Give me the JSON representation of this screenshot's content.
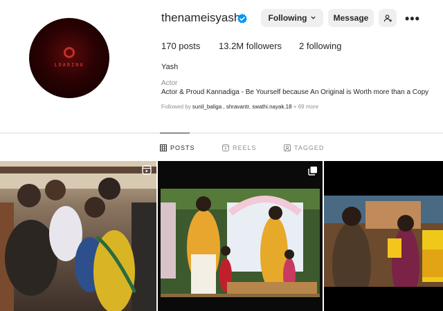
{
  "profile": {
    "username": "thenameisyash",
    "avatar_text": "LOADING",
    "buttons": {
      "following": "Following",
      "message": "Message"
    },
    "stats": {
      "posts": "170 posts",
      "followers": "13.2M followers",
      "following": "2 following"
    },
    "full_name": "Yash",
    "category": "Actor",
    "bio": "Actor & Proud Kannadiga - Be Yourself because An Original is Worth more than a Copy",
    "followed_by_prefix": "Followed by",
    "followed_by_names": "sunil_baliga , shravantr, swathi.nayak.18",
    "followed_by_more": "+ 69 more"
  },
  "tabs": [
    {
      "label": "POSTS",
      "icon": "grid-icon",
      "active": true
    },
    {
      "label": "REELS",
      "icon": "reels-icon",
      "active": false
    },
    {
      "label": "TAGGED",
      "icon": "tagged-icon",
      "active": false
    }
  ],
  "posts": [
    {
      "kind": "reel",
      "icon": "reel-icon"
    },
    {
      "kind": "carousel",
      "icon": "multiple-images-icon"
    },
    {
      "kind": "image"
    }
  ],
  "colors": {
    "verified": "#0095f6",
    "button_bg": "#efefef",
    "muted_text": "#8e8e8e",
    "divider": "#dbdbdb"
  }
}
